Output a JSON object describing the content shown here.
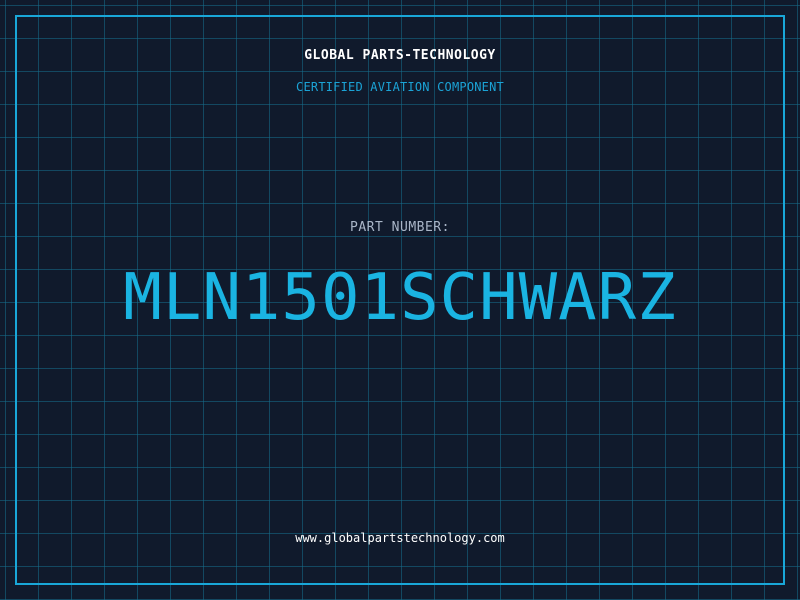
{
  "header": {
    "company": "GLOBAL PARTS-TECHNOLOGY",
    "subtitle": "CERTIFIED AVIATION COMPONENT"
  },
  "main": {
    "part_label": "PART NUMBER:",
    "part_number": "MLN1501SCHWARZ"
  },
  "footer": {
    "website": "www.globalpartstechnology.com"
  },
  "colors": {
    "background": "#101a2c",
    "grid": "#166e8c",
    "accent": "#1ab4e2",
    "text": "#ffffff"
  }
}
